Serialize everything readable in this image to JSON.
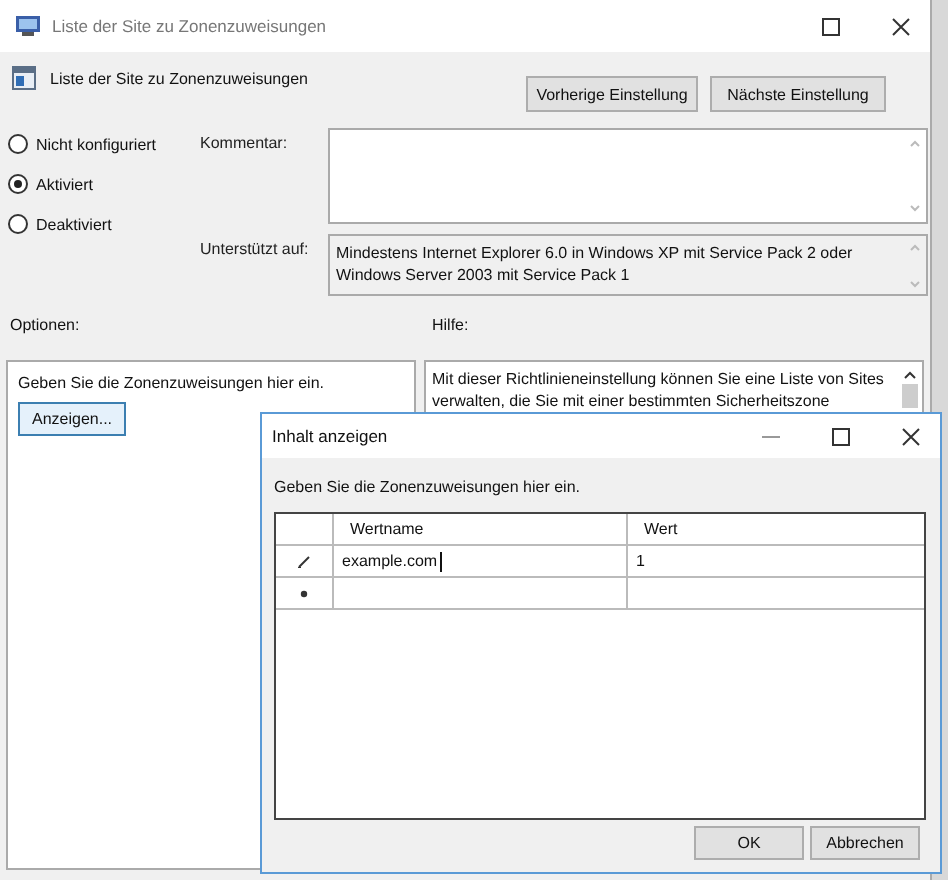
{
  "window": {
    "title": "Liste der Site zu Zonenzuweisungen"
  },
  "header": {
    "title": "Liste der Site zu Zonenzuweisungen",
    "buttons": [
      "Vorherige Einstellung",
      "Nächste Einstellung"
    ]
  },
  "state_options": [
    {
      "label": "Nicht konfiguriert",
      "selected": false
    },
    {
      "label": "Aktiviert",
      "selected": true
    },
    {
      "label": "Deaktiviert",
      "selected": false
    }
  ],
  "comment": {
    "label": "Kommentar:"
  },
  "supported": {
    "label": "Unterstützt auf:",
    "value": "Mindestens Internet Explorer 6.0 in Windows XP mit Service Pack 2 oder\nWindows Server 2003 mit Service Pack 1"
  },
  "options": {
    "label": "Optionen:",
    "text": "Geben Sie die Zonenzuweisungen hier ein.",
    "button": "Anzeigen..."
  },
  "help": {
    "label": "Hilfe:",
    "text": "Mit dieser Richtlinieneinstellung können Sie eine Liste von Sites\nverwalten, die Sie mit einer bestimmten Sicherheitszone"
  },
  "dialog": {
    "title": "Inhalt anzeigen",
    "text": "Geben Sie die Zonenzuweisungen hier ein.",
    "columns": [
      "Wertname",
      "Wert"
    ],
    "rows": [
      {
        "kind": "editing",
        "name": "example.com",
        "value": "1"
      },
      {
        "kind": "new"
      }
    ],
    "buttons": [
      "OK",
      "Abbrechen"
    ]
  }
}
